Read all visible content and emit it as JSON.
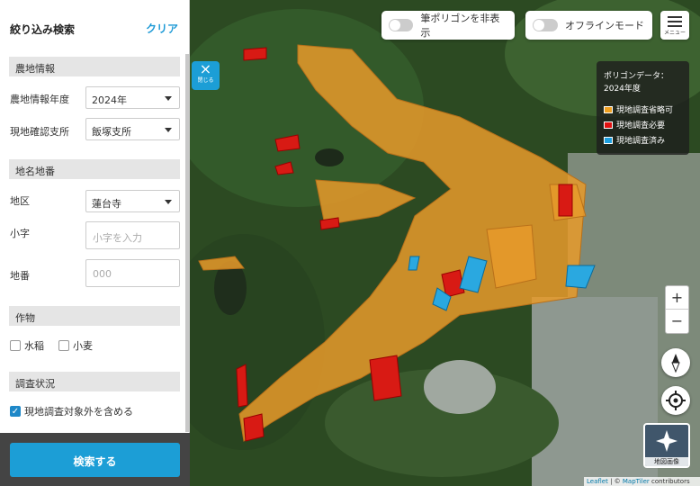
{
  "sidebar": {
    "title": "絞り込み検索",
    "clear": "クリア",
    "farm_section": "農地情報",
    "year_label": "農地情報年度",
    "year_value": "2024年",
    "office_label": "現地確認支所",
    "office_value": "飯塚支所",
    "place_section": "地名地番",
    "district_label": "地区",
    "district_value": "蓮台寺",
    "koaza_label": "小字",
    "koaza_placeholder": "小字を入力",
    "chiban_label": "地番",
    "chiban_placeholder": "000",
    "crop_section": "作物",
    "crop_rice": "水稲",
    "crop_wheat": "小麦",
    "survey_section": "調査状況",
    "include_excluded": "現地調査対象外を含める",
    "include_excluded_checked": true,
    "search_button": "検索する"
  },
  "map": {
    "hide_polygon_label": "筆ポリゴンを非表示",
    "offline_label": "オフラインモード",
    "menu_label": "メニュー",
    "close_label": "閉じる",
    "close_icon": "×",
    "legend": {
      "title": "ポリゴンデータ：",
      "year": "2024年度",
      "items": [
        {
          "label": "現地調査省略可",
          "color": "#f0a020"
        },
        {
          "label": "現地調査必要",
          "color": "#e01010"
        },
        {
          "label": "現地調査済み",
          "color": "#1ea0e0"
        }
      ]
    },
    "zoom_in": "+",
    "zoom_out": "−",
    "basemap_label": "地図画像",
    "attribution_leaflet": "Leaflet",
    "attribution_sep": " | © ",
    "attribution_tiler": "MapTiler",
    "attribution_rest": " contributors"
  }
}
